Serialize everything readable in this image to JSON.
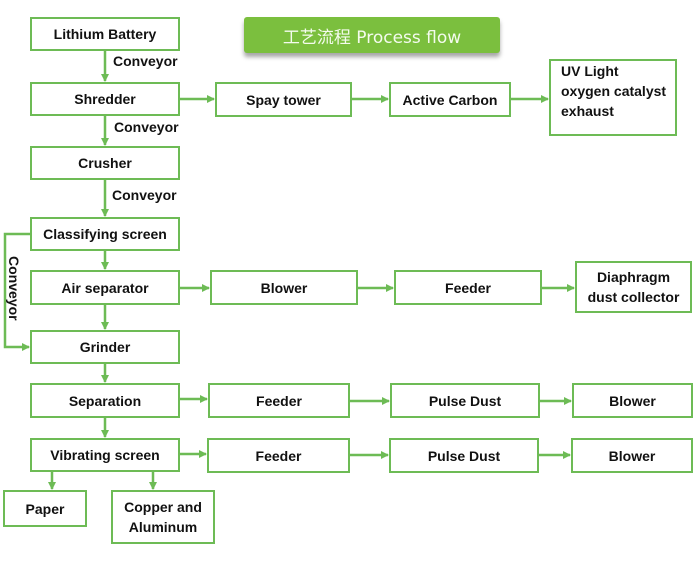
{
  "title": {
    "text": "工艺流程  Process flow",
    "color": "#7bbf3e"
  },
  "colors": {
    "box_border": "#6dbb55",
    "arrow": "#6dbb55",
    "text": "#111111"
  },
  "nodes": {
    "lithium_battery": "Lithium Battery",
    "shredder": "Shredder",
    "crusher": "Crusher",
    "classifying_screen": "Classifying screen",
    "air_separator": "Air separator",
    "grinder": "Grinder",
    "separation": "Separation",
    "vibrating_screen": "Vibrating screen",
    "paper": "Paper",
    "copper_aluminum": [
      "Copper and",
      "Aluminum"
    ],
    "spay_tower": "Spay tower",
    "active_carbon": "Active Carbon",
    "uv_light": [
      "UV Light",
      "oxygen catalyst",
      "exhaust"
    ],
    "air_blower": "Blower",
    "air_feeder": "Feeder",
    "diaphragm": [
      "Diaphragm",
      "dust collector"
    ],
    "sep_feeder": "Feeder",
    "sep_pulse": "Pulse Dust",
    "sep_blower": "Blower",
    "vib_feeder": "Feeder",
    "vib_pulse": "Pulse Dust",
    "vib_blower": "Blower"
  },
  "edge_labels": {
    "battery_to_shredder": "Conveyor",
    "shredder_to_crusher": "Conveyor",
    "crusher_to_classifying": "Conveyor",
    "classifying_to_grinder": "Conveyor"
  }
}
